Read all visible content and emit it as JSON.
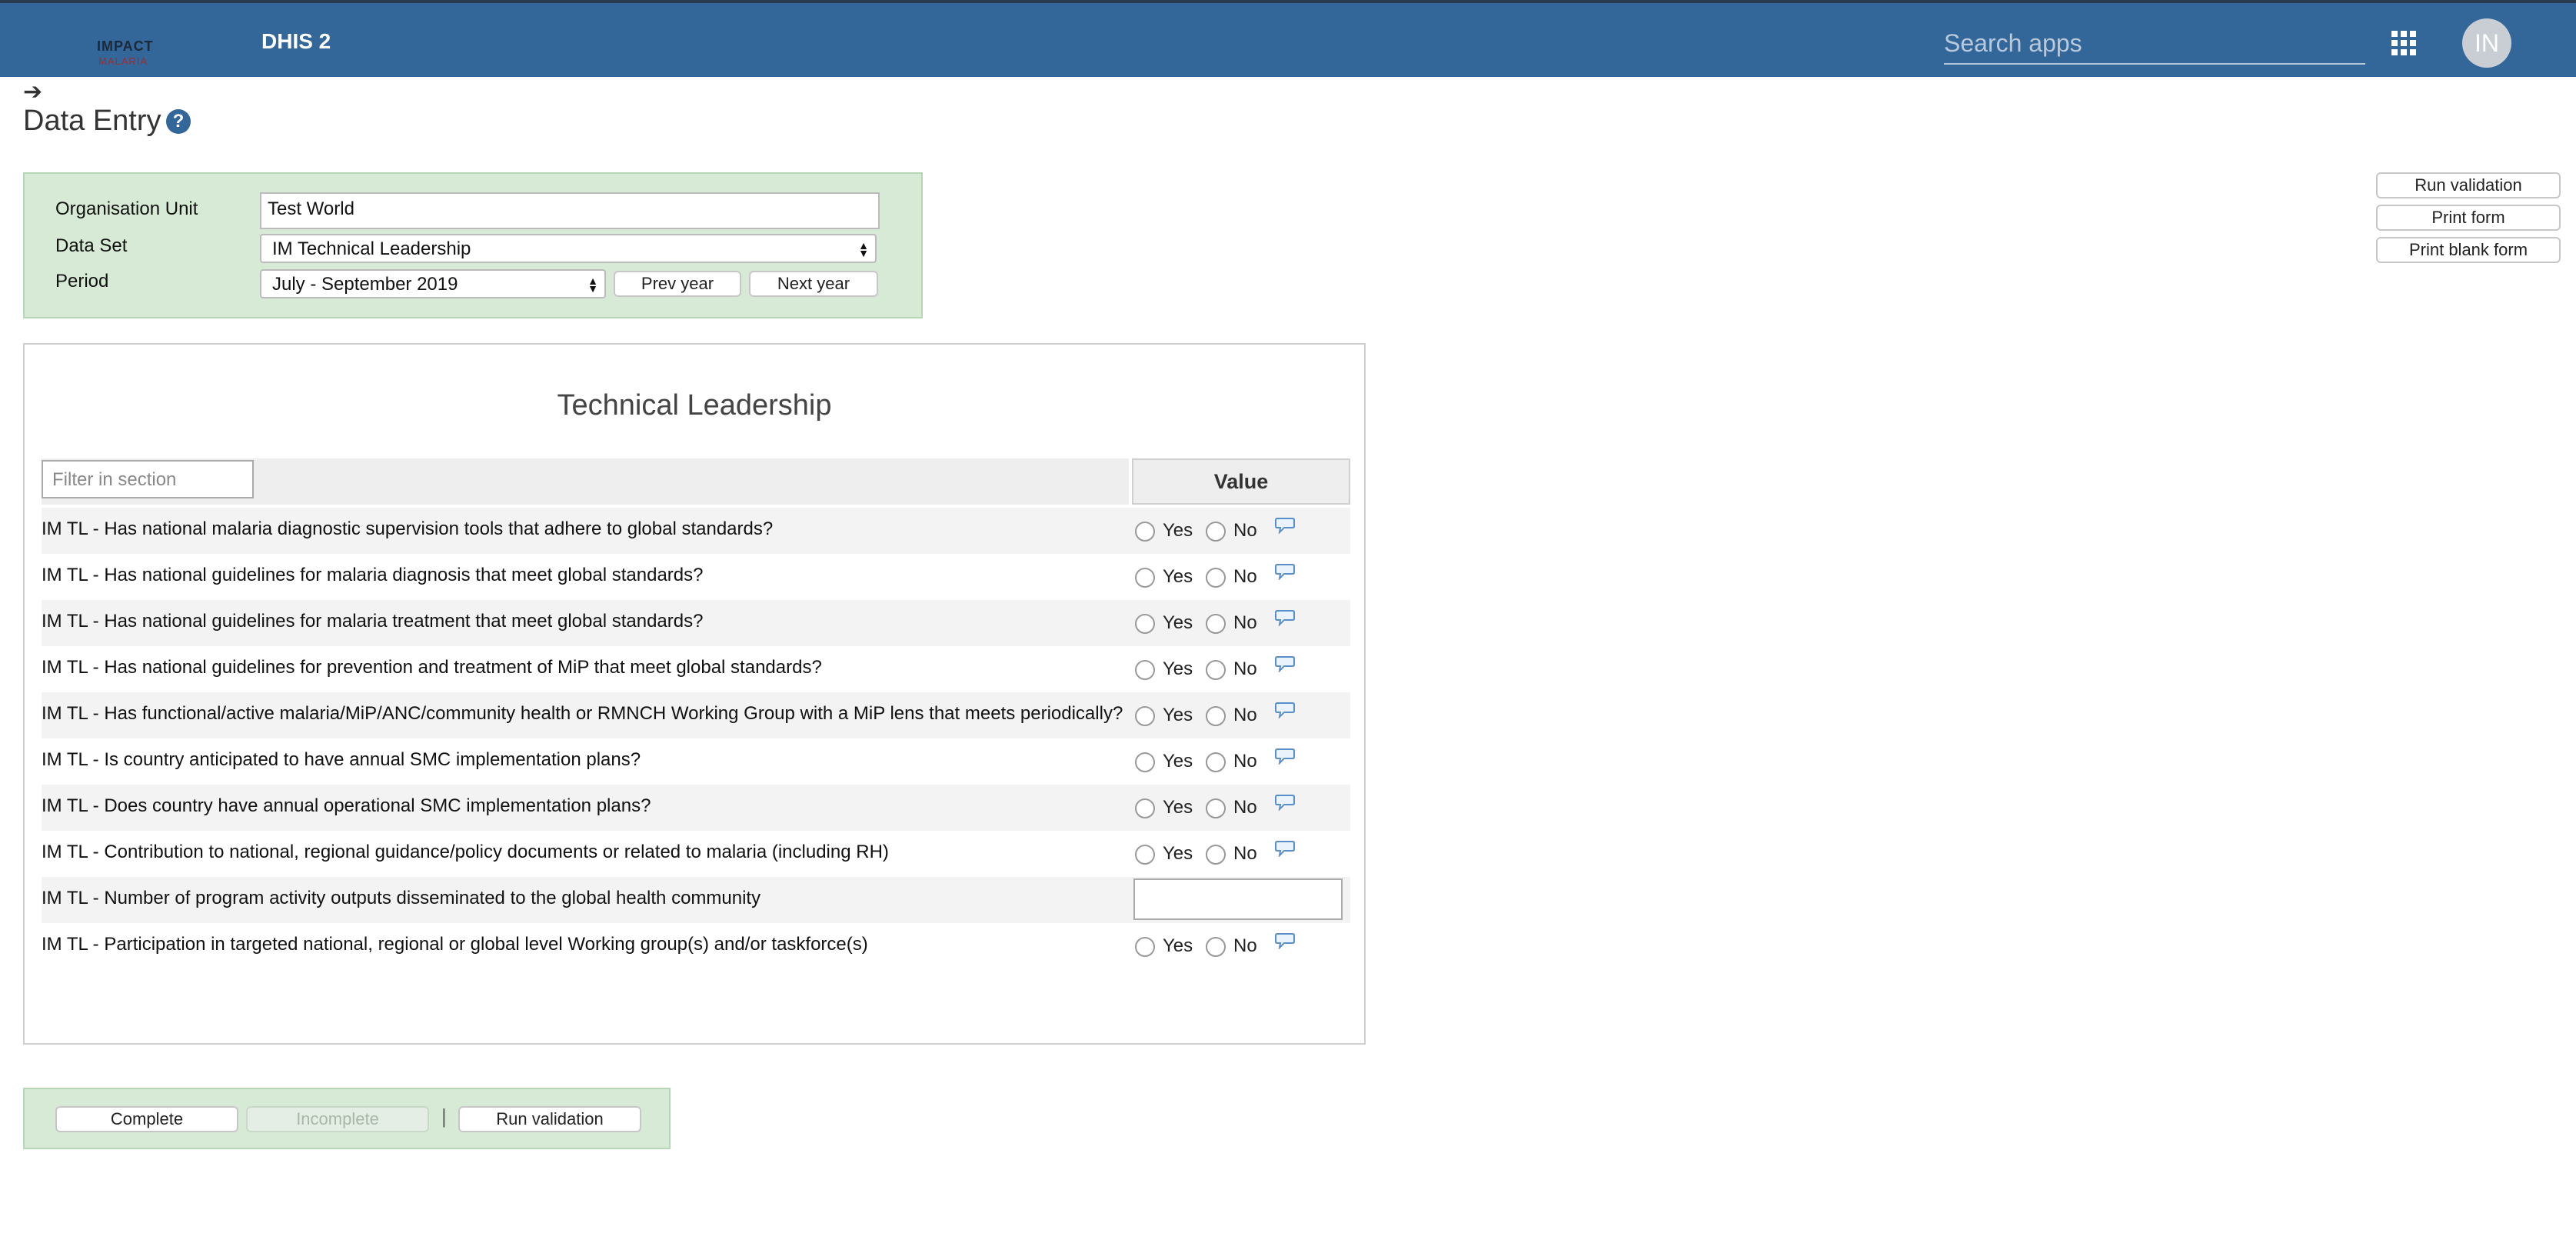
{
  "header": {
    "logo_top": "IMPACT",
    "logo_bottom": "MALARIA",
    "app_title": "DHIS 2",
    "search_placeholder": "Search apps",
    "apps_icon": "apps-grid-icon",
    "avatar_initials": "IN"
  },
  "page": {
    "title": "Data Entry",
    "help_icon_glyph": "?"
  },
  "selection": {
    "org_unit_label": "Organisation Unit",
    "org_unit_value": "Test World",
    "dataset_label": "Data Set",
    "dataset_value": "IM Technical Leadership",
    "period_label": "Period",
    "period_value": "July - September 2019",
    "prev_year": "Prev year",
    "next_year": "Next year"
  },
  "actions": {
    "run_validation": "Run validation",
    "print_form": "Print form",
    "print_blank_form": "Print blank form"
  },
  "section": {
    "title": "Technical Leadership",
    "filter_placeholder": "Filter in section",
    "value_header": "Value",
    "yes": "Yes",
    "no": "No",
    "rows": [
      {
        "label": "IM TL - Has national malaria diagnostic supervision tools that adhere to global standards?",
        "type": "yesno"
      },
      {
        "label": "IM TL - Has national guidelines for malaria diagnosis that meet global standards?",
        "type": "yesno"
      },
      {
        "label": "IM TL - Has national guidelines for malaria treatment that meet global standards?",
        "type": "yesno"
      },
      {
        "label": "IM TL - Has national guidelines for prevention and treatment of MiP that meet global standards?",
        "type": "yesno"
      },
      {
        "label": "IM TL - Has functional/active malaria/MiP/ANC/community health or RMNCH Working Group with a MiP lens that meets periodically?",
        "type": "yesno"
      },
      {
        "label": "IM TL - Is country anticipated to have annual SMC implementation plans?",
        "type": "yesno"
      },
      {
        "label": "IM TL - Does country have annual operational SMC implementation plans?",
        "type": "yesno"
      },
      {
        "label": "IM TL - Contribution to national, regional guidance/policy documents or related to malaria (including RH)",
        "type": "yesno"
      },
      {
        "label": "IM TL - Number of program activity outputs disseminated to the global health community",
        "type": "number"
      },
      {
        "label": "IM TL - Participation in targeted national, regional or global level Working group(s) and/or taskforce(s)",
        "type": "yesno"
      }
    ]
  },
  "completeness": {
    "complete": "Complete",
    "incomplete": "Incomplete",
    "separator": "|",
    "run_validation": "Run validation"
  }
}
